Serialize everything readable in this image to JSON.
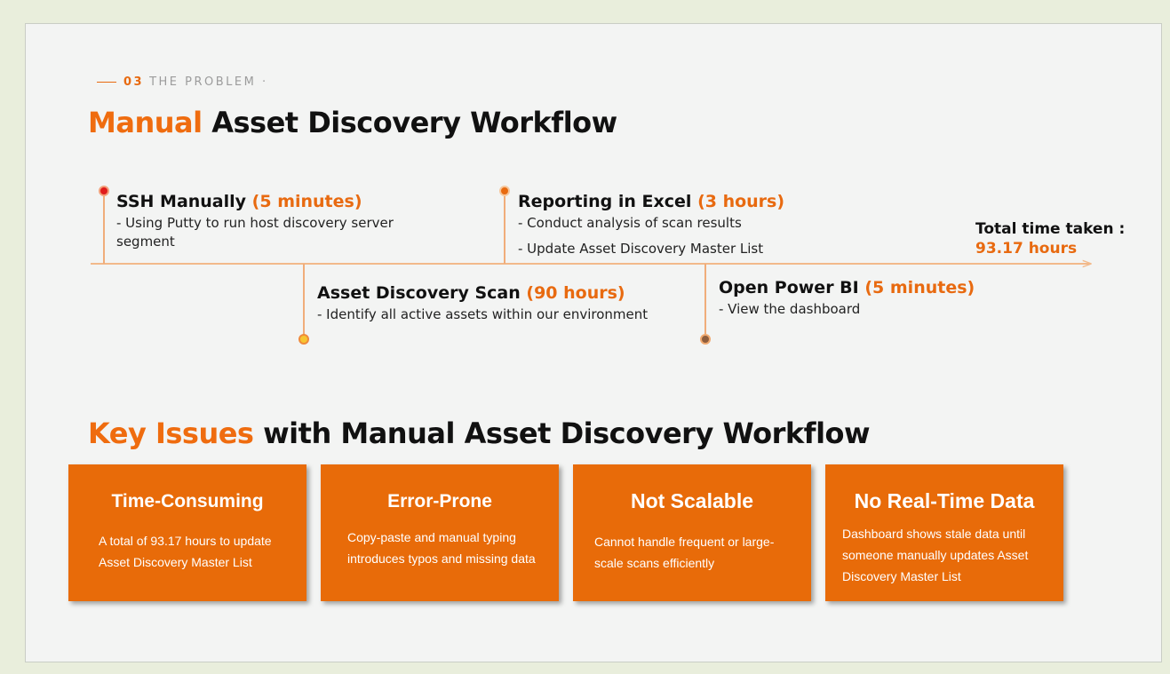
{
  "section": {
    "number": "03",
    "label": "THE PROBLEM ·"
  },
  "title": {
    "accent": "Manual",
    "rest": "Asset Discovery Workflow"
  },
  "timeline": [
    {
      "title": "SSH Manually",
      "time": "(5 minutes)",
      "lines": [
        "- Using Putty to run host discovery server",
        "segment"
      ]
    },
    {
      "title": "Asset Discovery Scan",
      "time": "(90 hours)",
      "lines": [
        "- Identify all active assets within our environment"
      ]
    },
    {
      "title": "Reporting in Excel",
      "time": "(3 hours)",
      "lines": [
        "- Conduct analysis of scan results",
        "- Update Asset Discovery Master List"
      ]
    },
    {
      "title": "Open Power BI",
      "time": "(5 minutes)",
      "lines": [
        "- View the dashboard"
      ]
    }
  ],
  "total": {
    "label": "Total time taken :",
    "value": "93.17 hours"
  },
  "issues_title": {
    "accent": "Key Issues",
    "rest": "with Manual Asset Discovery Workflow"
  },
  "issues": [
    {
      "title": "Time-Consuming",
      "lines": [
        "A total of 93.17 hours to update",
        "Asset Discovery Master List"
      ]
    },
    {
      "title": "Error-Prone",
      "lines": [
        "Copy-paste and manual typing",
        "introduces typos and missing data"
      ]
    },
    {
      "title": "Not Scalable",
      "lines": [
        "Cannot handle frequent or large-",
        "scale scans efficiently"
      ]
    },
    {
      "title": "No Real-Time Data",
      "lines": [
        "Dashboard shows stale data until",
        "someone manually updates Asset",
        "Discovery Master List"
      ]
    }
  ],
  "colors": {
    "accent": "#ef6c0f",
    "card": "#e86b09",
    "timeline": "#f2b98a"
  }
}
